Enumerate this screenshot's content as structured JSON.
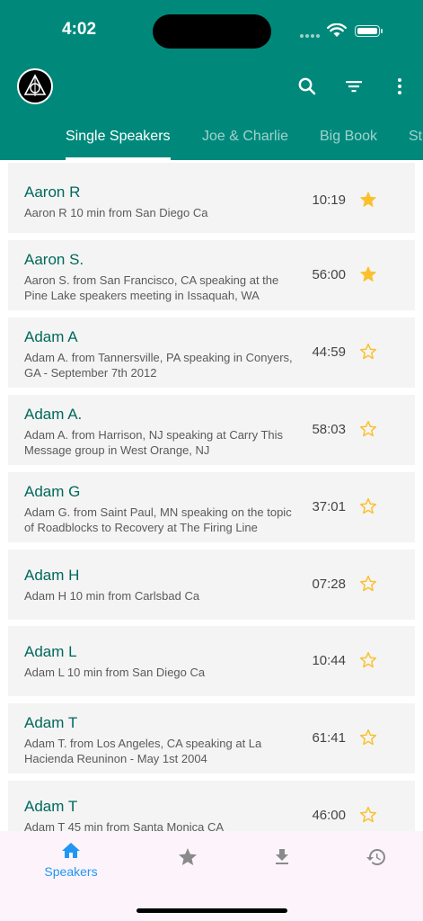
{
  "status_bar": {
    "time": "4:02"
  },
  "app_bar": {
    "logo_icon": "triangle-circle-logo",
    "actions": [
      "search-icon",
      "filter-icon",
      "more-vert-icon"
    ]
  },
  "tabs": [
    {
      "label": "Single Speakers",
      "active": true
    },
    {
      "label": "Joe & Charlie",
      "active": false
    },
    {
      "label": "Big Book",
      "active": false
    },
    {
      "label": "St",
      "active": false
    }
  ],
  "speakers": [
    {
      "name": "Aaron R",
      "description": "Aaron R 10 min from San Diego Ca",
      "duration": "10:19",
      "favorite": true
    },
    {
      "name": "Aaron S.",
      "description": "Aaron S. from San Francisco, CA speaking at the Pine Lake speakers meeting in Issaquah, WA",
      "duration": "56:00",
      "favorite": true
    },
    {
      "name": "Adam A",
      "description": "Adam A. from Tannersville, PA speaking in Conyers, GA - September 7th 2012",
      "duration": "44:59",
      "favorite": false
    },
    {
      "name": "Adam A.",
      "description": "Adam A. from Harrison, NJ speaking at Carry This Message group in West Orange, NJ",
      "duration": "58:03",
      "favorite": false
    },
    {
      "name": "Adam G",
      "description": "Adam G. from Saint Paul, MN speaking on the topic of Roadblocks to Recovery at The Firing Line",
      "duration": "37:01",
      "favorite": false
    },
    {
      "name": "Adam H",
      "description": "Adam H 10 min from Carlsbad Ca",
      "duration": "07:28",
      "favorite": false
    },
    {
      "name": "Adam L",
      "description": "Adam L 10 min from San Diego Ca",
      "duration": "10:44",
      "favorite": false
    },
    {
      "name": "Adam T",
      "description": "Adam T. from Los Angeles, CA speaking at La Hacienda Reuninon - May 1st 2004",
      "duration": "61:41",
      "favorite": false
    },
    {
      "name": "Adam T",
      "description": "Adam T 45 min from Santa Monica CA",
      "duration": "46:00",
      "favorite": false
    }
  ],
  "bottom_nav": [
    {
      "icon": "home-icon",
      "label": "Speakers",
      "active": true
    },
    {
      "icon": "star-icon",
      "active": false
    },
    {
      "icon": "download-icon",
      "active": false
    },
    {
      "icon": "history-icon",
      "active": false
    }
  ],
  "colors": {
    "app_bar": "#00897B",
    "title_text": "#00695C",
    "star": "#FBC02D",
    "nav_active": "#2196F3",
    "nav_inactive": "#8a8a8a",
    "row_background": "#f4f4f4"
  }
}
